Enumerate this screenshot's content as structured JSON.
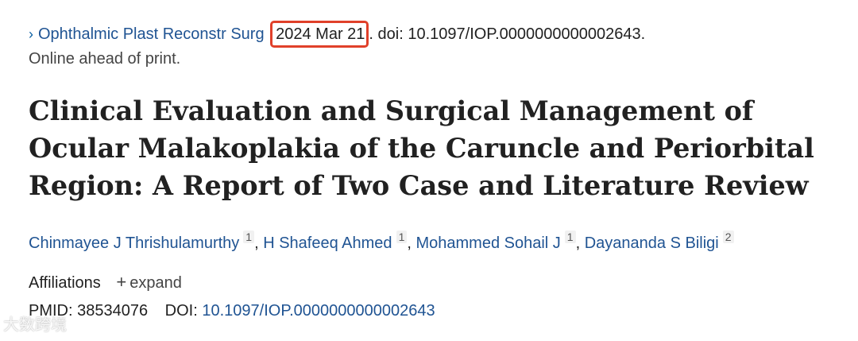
{
  "citation": {
    "chevron": "›",
    "journal": "Ophthalmic Plast Reconstr Surg",
    "date": "2024 Mar 21",
    "date_highlight_color": "#e0402a",
    "after_date": ". doi: 10.1097/IOP.0000000000002643.",
    "status": "Online ahead of print."
  },
  "article": {
    "title": "Clinical Evaluation and Surgical Management of Ocular Malakoplakia of the Caruncle and Periorbital Region: A Report of Two Case and Literature Review"
  },
  "authors": [
    {
      "name": "Chinmayee J Thrishulamurthy",
      "affiliation": "1",
      "sep": ","
    },
    {
      "name": "H Shafeeq Ahmed",
      "affiliation": "1",
      "sep": ","
    },
    {
      "name": "Mohammed Sohail J",
      "affiliation": "1",
      "sep": ","
    },
    {
      "name": "Dayananda S Biligi",
      "affiliation": "2",
      "sep": ""
    }
  ],
  "affiliations": {
    "label": "Affiliations",
    "expand_icon": "+",
    "expand_label": "expand"
  },
  "identifiers": {
    "pmid_label": "PMID:",
    "pmid": "38534076",
    "doi_label": "DOI:",
    "doi": "10.1097/IOP.0000000000002643"
  },
  "watermark": {
    "text": "大数跨境"
  },
  "colors": {
    "link": "#205493",
    "text": "#212121"
  }
}
